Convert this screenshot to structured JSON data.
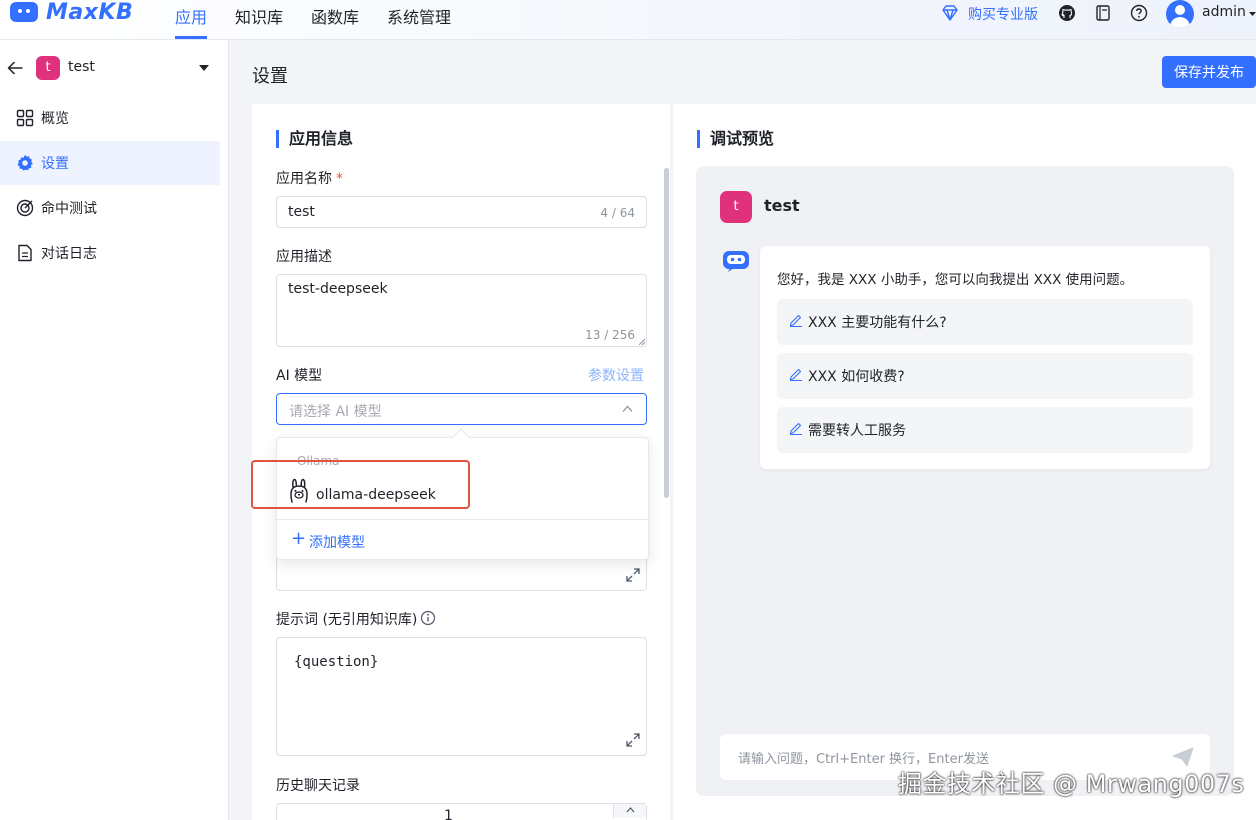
{
  "header": {
    "logo_text": "MaxKB",
    "nav": [
      "应用",
      "知识库",
      "函数库",
      "系统管理"
    ],
    "buy_pro": "购买专业版",
    "user": "admin",
    "icons": [
      "diamond-icon",
      "github-icon",
      "book-icon",
      "help-icon",
      "user-avatar-icon"
    ]
  },
  "sidebar": {
    "app_badge": "t",
    "app_name": "test",
    "items": [
      {
        "label": "概览",
        "icon": "grid-icon"
      },
      {
        "label": "设置",
        "icon": "gear-icon",
        "active": true
      },
      {
        "label": "命中测试",
        "icon": "target-icon"
      },
      {
        "label": "对话日志",
        "icon": "document-icon"
      }
    ]
  },
  "main": {
    "title": "设置",
    "publish_button": "保存并发布"
  },
  "form": {
    "section_title": "应用信息",
    "name_label": "应用名称",
    "required_mark": "*",
    "name_value": "test",
    "name_counter": "4 / 64",
    "desc_label": "应用描述",
    "desc_value": "test-deepseek",
    "desc_counter": "13 / 256",
    "model_label": "AI 模型",
    "param_settings": "参数设置",
    "model_placeholder": "请选择 AI 模型",
    "prompt_label": "提示词 (无引用知识库)",
    "prompt_value": "{question}",
    "history_label": "历史聊天记录",
    "history_value": "1"
  },
  "dropdown": {
    "group": "Ollama",
    "option": "ollama-deepseek",
    "add_model": "添加模型"
  },
  "preview": {
    "section_title": "调试预览",
    "app_badge": "t",
    "app_name": "test",
    "greeting": "您好，我是 XXX 小助手，您可以向我提出 XXX 使用问题。",
    "questions": [
      "XXX 主要功能有什么?",
      "XXX 如何收费?",
      "需要转人工服务"
    ],
    "input_placeholder": "请输入问题，Ctrl+Enter 换行，Enter发送"
  },
  "watermark": "掘金技术社区 @ Mrwang007s",
  "colors": {
    "accent": "#3370ff",
    "badge": "#e0317c",
    "highlight": "#e0553f"
  }
}
